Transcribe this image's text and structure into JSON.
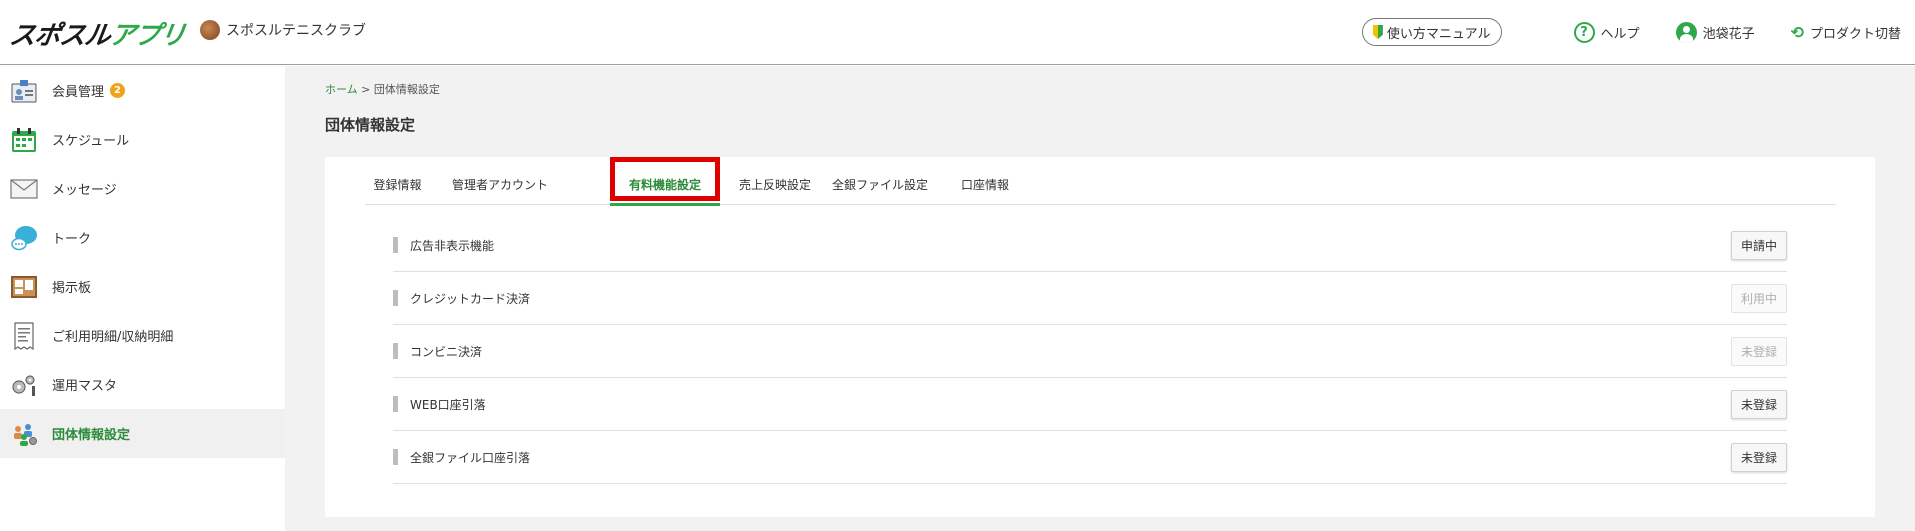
{
  "header": {
    "logo_main": "スポスル",
    "logo_accent": "アプリ",
    "club_name": "スポスルテニスクラブ",
    "manual_label": "使い方マニュアル",
    "help_label": "ヘルプ",
    "help_icon_glyph": "?",
    "user_name": "池袋花子",
    "product_switch_label": "プロダクト切替",
    "accent_color": "#2fa84a"
  },
  "sidebar": {
    "items": [
      {
        "label": "会員管理",
        "badge": "2",
        "icon": "member-card-icon"
      },
      {
        "label": "スケジュール",
        "icon": "calendar-icon"
      },
      {
        "label": "メッセージ",
        "icon": "envelope-icon"
      },
      {
        "label": "トーク",
        "icon": "chat-bubble-icon"
      },
      {
        "label": "掲示板",
        "icon": "bulletin-board-icon"
      },
      {
        "label": "ご利用明細/収納明細",
        "icon": "receipt-icon"
      },
      {
        "label": "運用マスタ",
        "icon": "gears-icon"
      },
      {
        "label": "団体情報設定",
        "icon": "group-settings-icon",
        "active": true
      }
    ]
  },
  "breadcrumb": {
    "home": "ホーム",
    "separator": ">",
    "current": "団体情報設定"
  },
  "page_title": "団体情報設定",
  "tabs": [
    {
      "label": "登録情報"
    },
    {
      "label": "管理者アカウント"
    },
    {
      "label": "有料機能設定",
      "active": true
    },
    {
      "label": "売上反映設定"
    },
    {
      "label": "全銀ファイル設定"
    },
    {
      "label": "口座情報"
    }
  ],
  "features": [
    {
      "label": "広告非表示機能",
      "status": "申請中",
      "enabled": true
    },
    {
      "label": "クレジットカード決済",
      "status": "利用中",
      "enabled": false
    },
    {
      "label": "コンビニ決済",
      "status": "未登録",
      "enabled": false
    },
    {
      "label": "WEB口座引落",
      "status": "未登録",
      "enabled": true
    },
    {
      "label": "全銀ファイル口座引落",
      "status": "未登録",
      "enabled": true
    }
  ],
  "highlight_color": "#e00000"
}
